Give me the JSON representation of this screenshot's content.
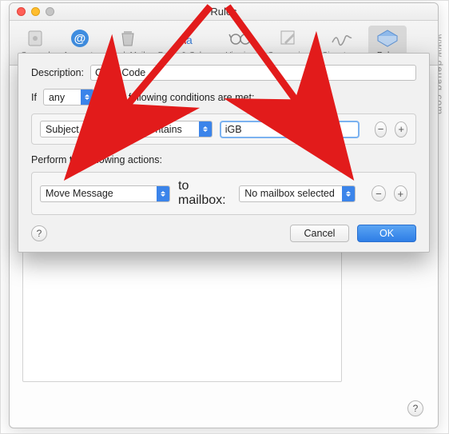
{
  "window": {
    "title": "Rules"
  },
  "toolbar": {
    "items": [
      {
        "label": "General"
      },
      {
        "label": "Accounts"
      },
      {
        "label": "Junk Mail"
      },
      {
        "label": "Fonts & Colors"
      },
      {
        "label": "Viewing"
      },
      {
        "label": "Composing"
      },
      {
        "label": "Signatures"
      },
      {
        "label": "Rules"
      }
    ]
  },
  "sheet": {
    "description_label": "Description:",
    "description_value": "Color Code",
    "if_label": "If",
    "if_select": "any",
    "if_tail": "of the following conditions are met:",
    "cond_field": "Subject",
    "cond_op": "contains",
    "cond_value": "iGB",
    "actions_title": "Perform the following actions:",
    "action_select": "Move Message",
    "action_mid": "to mailbox:",
    "action_target": "No mailbox selected",
    "remove": "−",
    "add": "+",
    "help": "?",
    "cancel": "Cancel",
    "ok": "OK"
  },
  "watermark": "www.deuaq.com"
}
